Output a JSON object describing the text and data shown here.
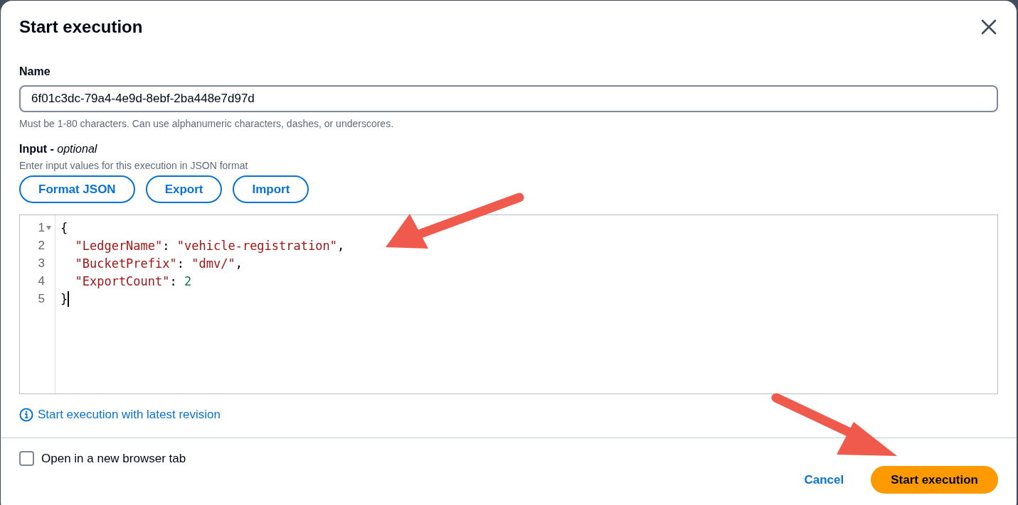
{
  "dialog": {
    "title": "Start execution"
  },
  "name_field": {
    "label": "Name",
    "value": "6f01c3dc-79a4-4e9d-8ebf-2ba448e7d97d",
    "hint": "Must be 1-80 characters. Can use alphanumeric characters, dashes, or underscores."
  },
  "input_field": {
    "label": "Input - ",
    "label_suffix": "optional",
    "description": "Enter input values for this execution in JSON format"
  },
  "editor_buttons": [
    "Format JSON",
    "Export",
    "Import"
  ],
  "editor": {
    "lines": [
      {
        "number": "1",
        "foldable": true,
        "tokens": [
          {
            "kind": "punct",
            "text": "{"
          }
        ]
      },
      {
        "number": "2",
        "foldable": false,
        "tokens": [
          {
            "kind": "key",
            "text": "  \"LedgerName\""
          },
          {
            "kind": "punct",
            "text": ": "
          },
          {
            "kind": "string",
            "text": "\"vehicle-registration\""
          },
          {
            "kind": "punct",
            "text": ","
          }
        ]
      },
      {
        "number": "3",
        "foldable": false,
        "tokens": [
          {
            "kind": "key",
            "text": "  \"BucketPrefix\""
          },
          {
            "kind": "punct",
            "text": ": "
          },
          {
            "kind": "string",
            "text": "\"dmv/\""
          },
          {
            "kind": "punct",
            "text": ","
          }
        ]
      },
      {
        "number": "4",
        "foldable": false,
        "tokens": [
          {
            "kind": "key",
            "text": "  \"ExportCount\""
          },
          {
            "kind": "punct",
            "text": ": "
          },
          {
            "kind": "number",
            "text": "2"
          }
        ]
      },
      {
        "number": "5",
        "foldable": false,
        "cursor": true,
        "tokens": [
          {
            "kind": "punct",
            "text": "}"
          }
        ]
      }
    ]
  },
  "revision_link": "Start execution with latest revision",
  "new_tab_checkbox": {
    "label": "Open in a new browser tab",
    "checked": false
  },
  "footer_buttons": [
    {
      "label": "Cancel",
      "kind": "link"
    },
    {
      "label": "Start execution",
      "kind": "primary"
    }
  ]
}
